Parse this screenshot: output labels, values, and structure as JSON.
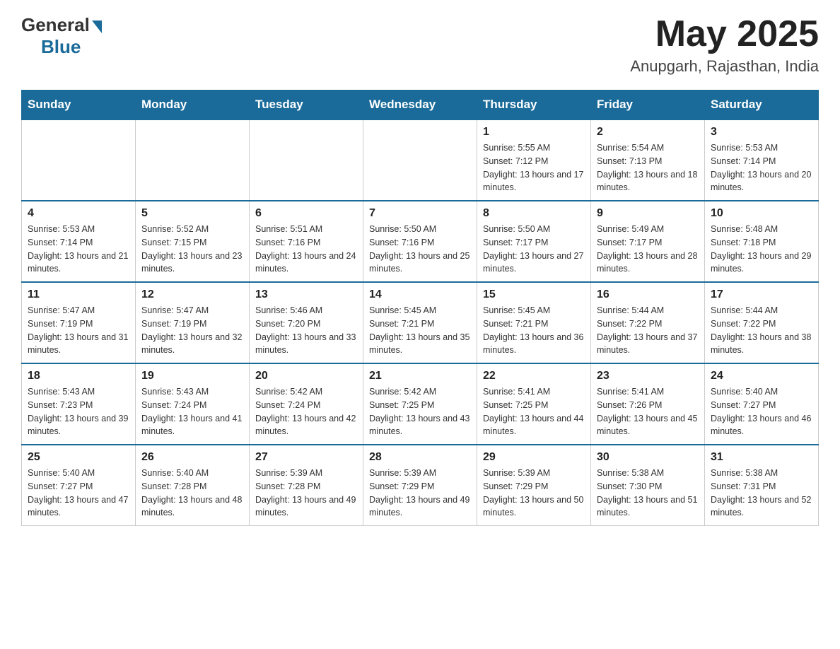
{
  "header": {
    "logo_general": "General",
    "logo_blue": "Blue",
    "month_year": "May 2025",
    "location": "Anupgarh, Rajasthan, India"
  },
  "days_of_week": [
    "Sunday",
    "Monday",
    "Tuesday",
    "Wednesday",
    "Thursday",
    "Friday",
    "Saturday"
  ],
  "weeks": [
    [
      {
        "day": "",
        "info": ""
      },
      {
        "day": "",
        "info": ""
      },
      {
        "day": "",
        "info": ""
      },
      {
        "day": "",
        "info": ""
      },
      {
        "day": "1",
        "info": "Sunrise: 5:55 AM\nSunset: 7:12 PM\nDaylight: 13 hours and 17 minutes."
      },
      {
        "day": "2",
        "info": "Sunrise: 5:54 AM\nSunset: 7:13 PM\nDaylight: 13 hours and 18 minutes."
      },
      {
        "day": "3",
        "info": "Sunrise: 5:53 AM\nSunset: 7:14 PM\nDaylight: 13 hours and 20 minutes."
      }
    ],
    [
      {
        "day": "4",
        "info": "Sunrise: 5:53 AM\nSunset: 7:14 PM\nDaylight: 13 hours and 21 minutes."
      },
      {
        "day": "5",
        "info": "Sunrise: 5:52 AM\nSunset: 7:15 PM\nDaylight: 13 hours and 23 minutes."
      },
      {
        "day": "6",
        "info": "Sunrise: 5:51 AM\nSunset: 7:16 PM\nDaylight: 13 hours and 24 minutes."
      },
      {
        "day": "7",
        "info": "Sunrise: 5:50 AM\nSunset: 7:16 PM\nDaylight: 13 hours and 25 minutes."
      },
      {
        "day": "8",
        "info": "Sunrise: 5:50 AM\nSunset: 7:17 PM\nDaylight: 13 hours and 27 minutes."
      },
      {
        "day": "9",
        "info": "Sunrise: 5:49 AM\nSunset: 7:17 PM\nDaylight: 13 hours and 28 minutes."
      },
      {
        "day": "10",
        "info": "Sunrise: 5:48 AM\nSunset: 7:18 PM\nDaylight: 13 hours and 29 minutes."
      }
    ],
    [
      {
        "day": "11",
        "info": "Sunrise: 5:47 AM\nSunset: 7:19 PM\nDaylight: 13 hours and 31 minutes."
      },
      {
        "day": "12",
        "info": "Sunrise: 5:47 AM\nSunset: 7:19 PM\nDaylight: 13 hours and 32 minutes."
      },
      {
        "day": "13",
        "info": "Sunrise: 5:46 AM\nSunset: 7:20 PM\nDaylight: 13 hours and 33 minutes."
      },
      {
        "day": "14",
        "info": "Sunrise: 5:45 AM\nSunset: 7:21 PM\nDaylight: 13 hours and 35 minutes."
      },
      {
        "day": "15",
        "info": "Sunrise: 5:45 AM\nSunset: 7:21 PM\nDaylight: 13 hours and 36 minutes."
      },
      {
        "day": "16",
        "info": "Sunrise: 5:44 AM\nSunset: 7:22 PM\nDaylight: 13 hours and 37 minutes."
      },
      {
        "day": "17",
        "info": "Sunrise: 5:44 AM\nSunset: 7:22 PM\nDaylight: 13 hours and 38 minutes."
      }
    ],
    [
      {
        "day": "18",
        "info": "Sunrise: 5:43 AM\nSunset: 7:23 PM\nDaylight: 13 hours and 39 minutes."
      },
      {
        "day": "19",
        "info": "Sunrise: 5:43 AM\nSunset: 7:24 PM\nDaylight: 13 hours and 41 minutes."
      },
      {
        "day": "20",
        "info": "Sunrise: 5:42 AM\nSunset: 7:24 PM\nDaylight: 13 hours and 42 minutes."
      },
      {
        "day": "21",
        "info": "Sunrise: 5:42 AM\nSunset: 7:25 PM\nDaylight: 13 hours and 43 minutes."
      },
      {
        "day": "22",
        "info": "Sunrise: 5:41 AM\nSunset: 7:25 PM\nDaylight: 13 hours and 44 minutes."
      },
      {
        "day": "23",
        "info": "Sunrise: 5:41 AM\nSunset: 7:26 PM\nDaylight: 13 hours and 45 minutes."
      },
      {
        "day": "24",
        "info": "Sunrise: 5:40 AM\nSunset: 7:27 PM\nDaylight: 13 hours and 46 minutes."
      }
    ],
    [
      {
        "day": "25",
        "info": "Sunrise: 5:40 AM\nSunset: 7:27 PM\nDaylight: 13 hours and 47 minutes."
      },
      {
        "day": "26",
        "info": "Sunrise: 5:40 AM\nSunset: 7:28 PM\nDaylight: 13 hours and 48 minutes."
      },
      {
        "day": "27",
        "info": "Sunrise: 5:39 AM\nSunset: 7:28 PM\nDaylight: 13 hours and 49 minutes."
      },
      {
        "day": "28",
        "info": "Sunrise: 5:39 AM\nSunset: 7:29 PM\nDaylight: 13 hours and 49 minutes."
      },
      {
        "day": "29",
        "info": "Sunrise: 5:39 AM\nSunset: 7:29 PM\nDaylight: 13 hours and 50 minutes."
      },
      {
        "day": "30",
        "info": "Sunrise: 5:38 AM\nSunset: 7:30 PM\nDaylight: 13 hours and 51 minutes."
      },
      {
        "day": "31",
        "info": "Sunrise: 5:38 AM\nSunset: 7:31 PM\nDaylight: 13 hours and 52 minutes."
      }
    ]
  ]
}
